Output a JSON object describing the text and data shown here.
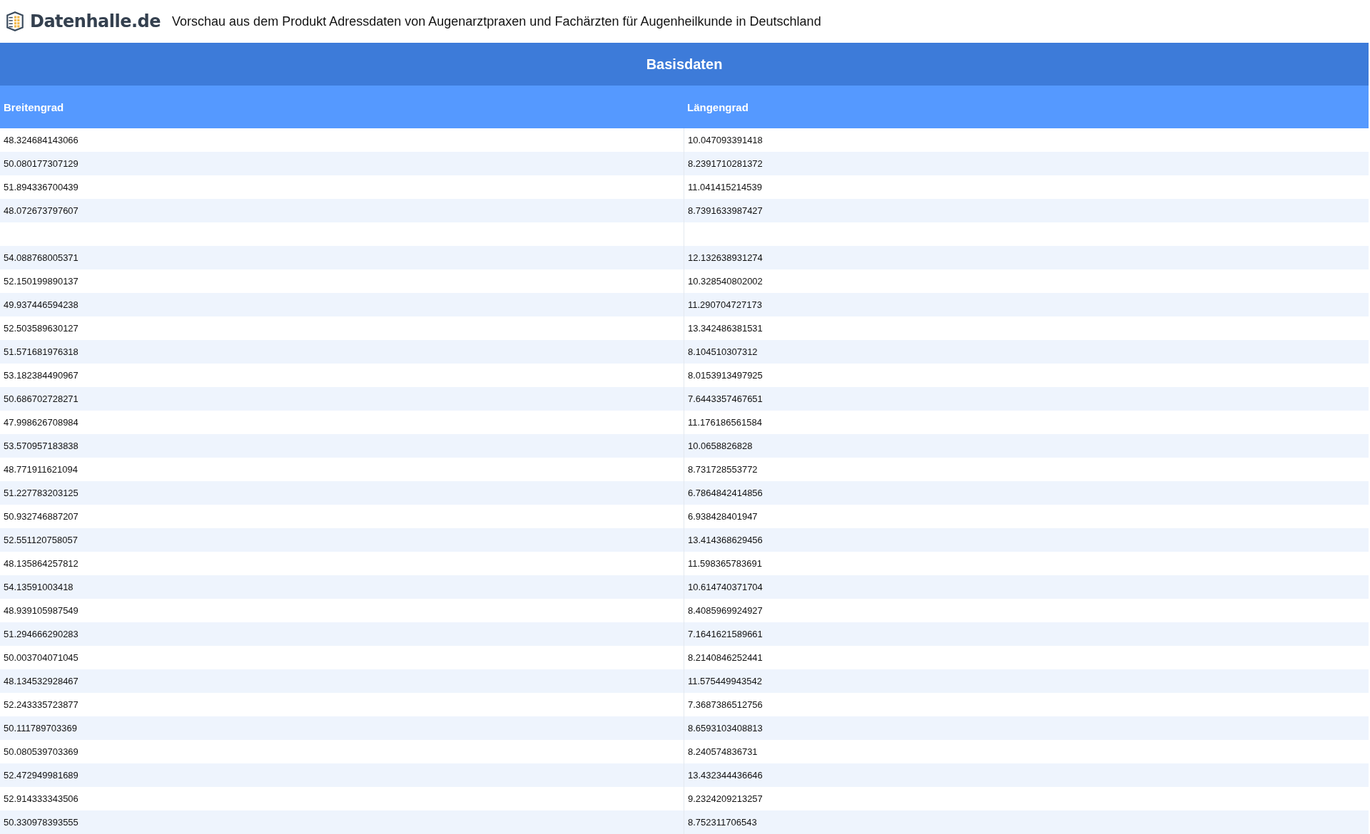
{
  "header": {
    "brand": "Datenhalle.de",
    "title": "Vorschau aus dem Produkt Adressdaten von Augenarztpraxen und Fachärzten für Augenheilkunde in Deutschland"
  },
  "table": {
    "group_title": "Basisdaten",
    "columns": [
      "Breitengrad",
      "Längengrad"
    ],
    "rows": [
      [
        "48.324684143066",
        "10.047093391418"
      ],
      [
        "50.080177307129",
        "8.2391710281372"
      ],
      [
        "51.894336700439",
        "11.041415214539"
      ],
      [
        "48.072673797607",
        "8.7391633987427"
      ],
      [],
      [
        "54.088768005371",
        "12.132638931274"
      ],
      [
        "52.150199890137",
        "10.328540802002"
      ],
      [
        "49.937446594238",
        "11.290704727173"
      ],
      [
        "52.503589630127",
        "13.342486381531"
      ],
      [
        "51.571681976318",
        "8.104510307312"
      ],
      [
        "53.182384490967",
        "8.0153913497925"
      ],
      [
        "50.686702728271",
        "7.6443357467651"
      ],
      [
        "47.998626708984",
        "11.176186561584"
      ],
      [
        "53.570957183838",
        "10.0658826828"
      ],
      [
        "48.771911621094",
        "8.731728553772"
      ],
      [
        "51.227783203125",
        "6.7864842414856"
      ],
      [
        "50.932746887207",
        "6.938428401947"
      ],
      [
        "52.551120758057",
        "13.414368629456"
      ],
      [
        "48.135864257812",
        "11.598365783691"
      ],
      [
        "54.13591003418",
        "10.614740371704"
      ],
      [
        "48.939105987549",
        "8.4085969924927"
      ],
      [
        "51.294666290283",
        "7.1641621589661"
      ],
      [
        "50.003704071045",
        "8.2140846252441"
      ],
      [
        "48.134532928467",
        "11.575449943542"
      ],
      [
        "52.243335723877",
        "7.3687386512756"
      ],
      [
        "50.111789703369",
        "8.6593103408813"
      ],
      [
        "50.080539703369",
        "8.240574836731"
      ],
      [
        "52.472949981689",
        "13.432344436646"
      ],
      [
        "52.914333343506",
        "9.2324209213257"
      ],
      [
        "50.330978393555",
        "8.752311706543"
      ]
    ]
  }
}
